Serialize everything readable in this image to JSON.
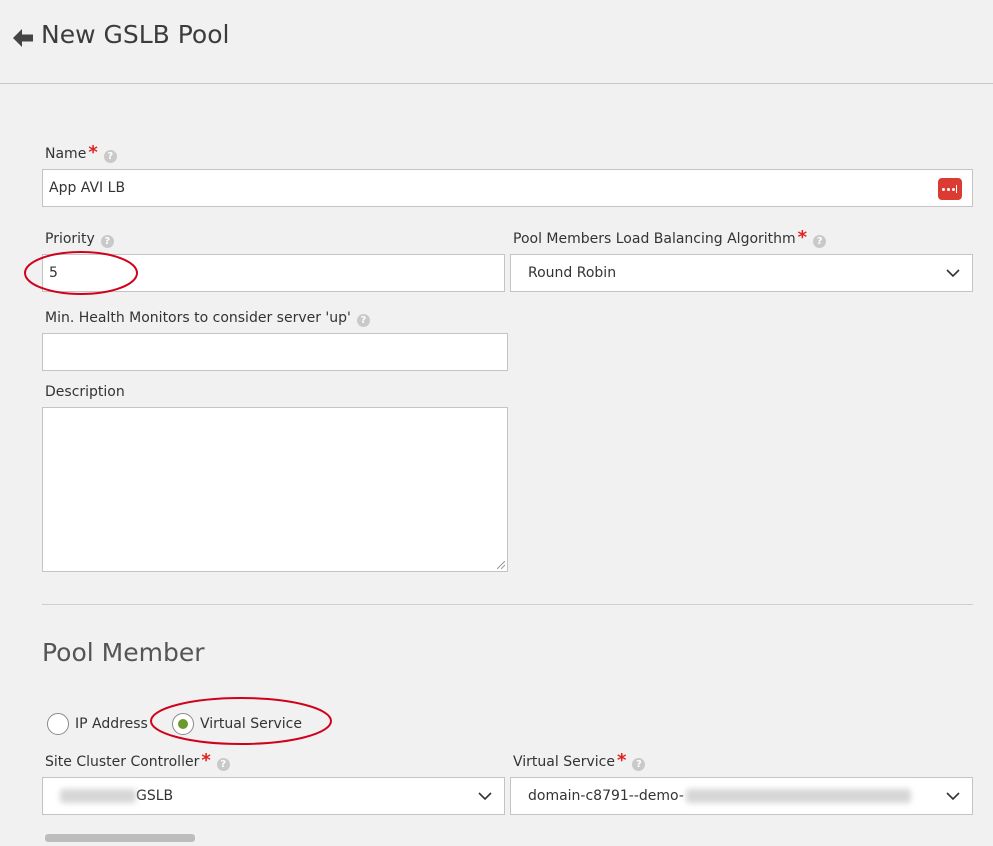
{
  "header": {
    "title": "New GSLB Pool"
  },
  "form": {
    "name": {
      "label": "Name",
      "value": "App AVI LB"
    },
    "priority": {
      "label": "Priority",
      "value": "5"
    },
    "algorithm": {
      "label": "Pool Members Load Balancing Algorithm",
      "value": "Round Robin"
    },
    "min_health": {
      "label": "Min. Health Monitors to consider server 'up'",
      "value": ""
    },
    "description": {
      "label": "Description",
      "value": ""
    }
  },
  "pool_member": {
    "title": "Pool Member",
    "options": [
      "IP Address",
      "Virtual Service"
    ],
    "selected": "Virtual Service",
    "site_cluster": {
      "label": "Site Cluster Controller",
      "value": "GSLB"
    },
    "virtual_service": {
      "label": "Virtual Service",
      "value": "domain-c8791--demo-"
    }
  },
  "colors": {
    "required": "#e0211d",
    "radio_selected": "#6a9a2c",
    "annotation": "#d0021b"
  }
}
